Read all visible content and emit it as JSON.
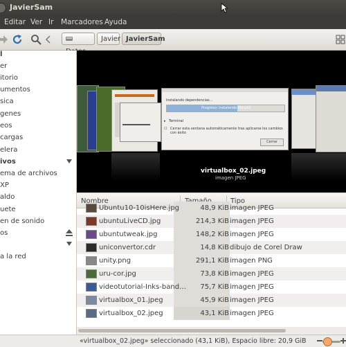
{
  "window": {
    "title": "JavierSam"
  },
  "menu": [
    "Editar",
    "Ver",
    "Ir",
    "Marcadores",
    "Ayuda"
  ],
  "toolbar": {
    "breadcrumbs": [
      "Datos",
      "Javier",
      "JavierSam"
    ]
  },
  "sidebar": {
    "items": [
      "l",
      "er",
      "itorio",
      "umentos",
      "sica",
      "genes",
      "eos",
      "cargas",
      "elera"
    ],
    "devices_header": "ivos",
    "device_items": [
      "ema de archivos",
      "XP",
      "aldo",
      "uete",
      "en de sonido",
      "os"
    ],
    "network_item": "a la red"
  },
  "preview": {
    "dialog": {
      "title": "Instalando dependencias…",
      "progress_text": "Progreso: instalando libcurl3",
      "progress": 0.6,
      "terminal_label": "Terminal",
      "checkbox_label": "Cerrar esta ventana automáticamente tras aplicarse los cambios con éxito",
      "button_label": "Cerrar"
    },
    "filename": "virtualbox_02.jpeg",
    "filetype": "imagen JPEG"
  },
  "list": {
    "columns": [
      "Nombre",
      "Tamaño",
      "Tipo"
    ],
    "rows": [
      {
        "name": "Ubuntu10-10isHere.jpg",
        "size": "48,9 KiB",
        "type": "imagen JPEG"
      },
      {
        "name": "ubuntuLiveCD.jpg",
        "size": "214,3 KiB",
        "type": "imagen JPEG"
      },
      {
        "name": "ubuntutweak.jpg",
        "size": "148,2 KiB",
        "type": "imagen JPEG"
      },
      {
        "name": "uniconvertor.cdr",
        "size": "14,8 KiB",
        "type": "dibujo de Corel Draw"
      },
      {
        "name": "unity.png",
        "size": "291,1 KiB",
        "type": "imagen PNG"
      },
      {
        "name": "uru-cor.jpg",
        "size": "73,8 KiB",
        "type": "imagen JPEG"
      },
      {
        "name": "videotutorial-Inks-band…",
        "size": "75,7 KiB",
        "type": "imagen JPEG"
      },
      {
        "name": "virtualbox_01.jpeg",
        "size": "45,9 KiB",
        "type": "imagen JPEG"
      },
      {
        "name": "virtualbox_02.jpeg",
        "size": "43,1 KiB",
        "type": "imagen JPEG"
      }
    ]
  },
  "status": {
    "text": "«virtualbox_02.jpeg» seleccionado (43,1 KiB), Espacio libre: 20,9 GiB"
  },
  "colors": {
    "titlebar": "#3c3b37",
    "accent": "#f4a96b",
    "selection": "#d9d6d1"
  }
}
